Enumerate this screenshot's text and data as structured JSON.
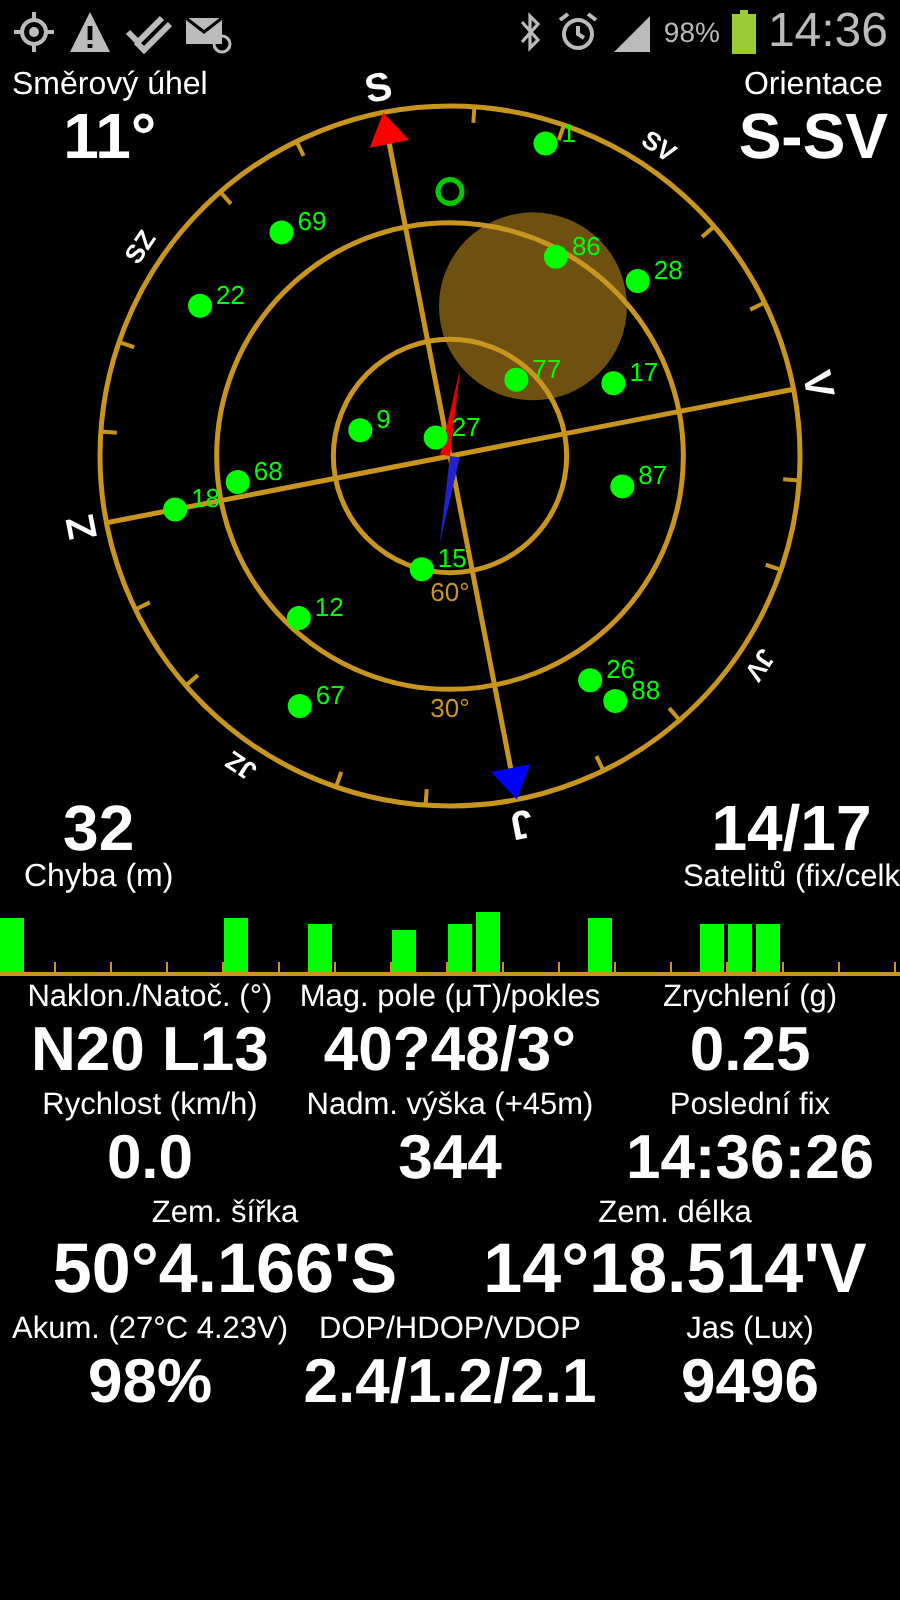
{
  "status_bar": {
    "battery_text": "98%",
    "time": "14:36"
  },
  "radar": {
    "compass": [
      {
        "text": "S",
        "kind": "major"
      },
      {
        "text": "SV",
        "kind": "minor"
      },
      {
        "text": "V",
        "kind": "major"
      },
      {
        "text": "JV",
        "kind": "minor"
      },
      {
        "text": "J",
        "kind": "major"
      },
      {
        "text": "JZ",
        "kind": "minor"
      },
      {
        "text": "Z",
        "kind": "major"
      },
      {
        "text": "SZ",
        "kind": "minor"
      }
    ],
    "ring_labels": [
      "60°",
      "30°"
    ],
    "satellites": [
      {
        "id": "1"
      },
      {
        "id": "69"
      },
      {
        "id": "22"
      },
      {
        "id": "86"
      },
      {
        "id": "28"
      },
      {
        "id": "77"
      },
      {
        "id": "17"
      },
      {
        "id": "9"
      },
      {
        "id": "27"
      },
      {
        "id": "68"
      },
      {
        "id": "18"
      },
      {
        "id": "87"
      },
      {
        "id": "15"
      },
      {
        "id": "12"
      },
      {
        "id": "67"
      },
      {
        "id": "26"
      },
      {
        "id": "88"
      }
    ],
    "corners": {
      "top_left": {
        "label": "Směrový úhel",
        "value": "11°"
      },
      "top_right": {
        "label": "Orientace",
        "value": "S-SV"
      },
      "bottom_left": {
        "label": "Chyba (m)",
        "value": "32"
      },
      "bottom_right": {
        "label": "Satelitů (fix/celk",
        "value": "14/17"
      }
    }
  },
  "readings": [
    [
      {
        "label": "Naklon./Natoč. (°)",
        "value": "N20 L13"
      },
      {
        "label": "Mag. pole (μT)/pokles",
        "value": "40?48/3°"
      },
      {
        "label": "Zrychlení (g)",
        "value": "0.25"
      }
    ],
    [
      {
        "label": "Rychlost (km/h)",
        "value": "0.0"
      },
      {
        "label": "Nadm. výška (+45m)",
        "value": "344"
      },
      {
        "label": "Poslední fix",
        "value": "14:36:26"
      }
    ],
    [
      {
        "label": "Zem. šířka",
        "value": "50°4.166'S"
      },
      {
        "label": "Zem. délka",
        "value": "14°18.514'V"
      }
    ],
    [
      {
        "label": "Akum. (27°C 4.23V)",
        "value": "98%"
      },
      {
        "label": "DOP/HDOP/VDOP",
        "value": "2.4/1.2/2.1"
      },
      {
        "label": "Jas (Lux)",
        "value": "9496"
      }
    ]
  ]
}
